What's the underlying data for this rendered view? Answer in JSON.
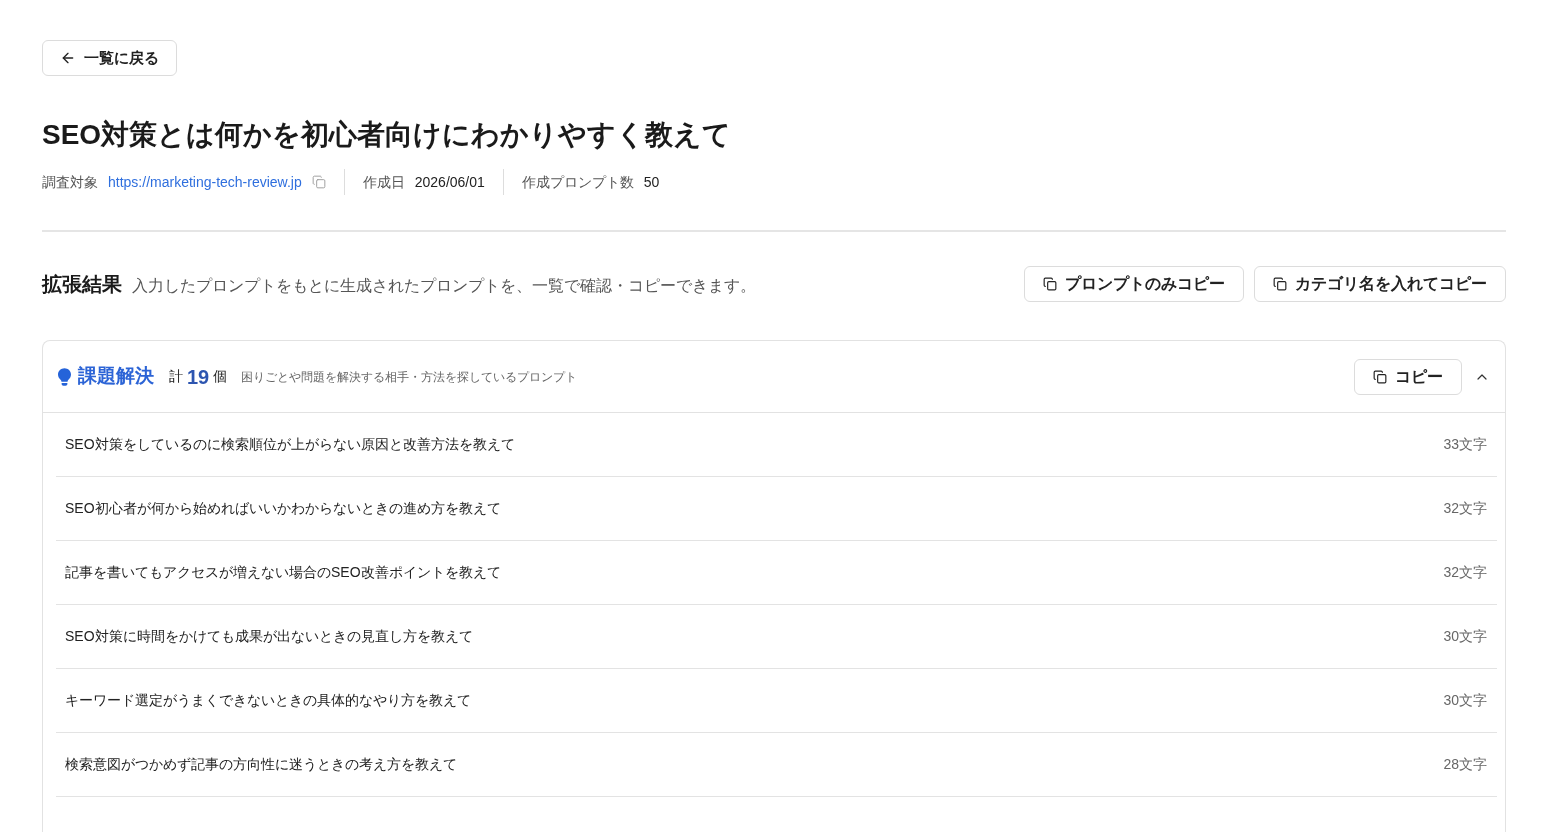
{
  "back_button": {
    "label": "一覧に戻る"
  },
  "title": "SEO対策とは何かを初心者向けにわかりやすく教えて",
  "meta": [
    {
      "kind": "link",
      "label": "調査対象",
      "value": "https://marketing-tech-review.jp"
    },
    {
      "kind": "text",
      "label": "作成日",
      "value": "2026/06/01"
    },
    {
      "kind": "text",
      "label": "作成プロンプト数",
      "value": "50"
    }
  ],
  "results": {
    "heading": "拡張結果",
    "description": "入力したプロンプトをもとに生成されたプロンプトを、一覧で確認・コピーできます。",
    "buttons": [
      "プロンプトのみコピー",
      "カテゴリ名を入れてコピー"
    ]
  },
  "categories": [
    {
      "name": "課題解決",
      "total_prefix": "計",
      "count": "19",
      "total_suffix": "個",
      "description": "困りごとや問題を解決する相手・方法を探しているプロンプト",
      "copy_button": "コピー",
      "expanded": true,
      "prompts": [
        {
          "text": "SEO対策をしているのに検索順位が上がらない原因と改善方法を教えて",
          "length": "33文字"
        },
        {
          "text": "SEO初心者が何から始めればいいかわからないときの進め方を教えて",
          "length": "32文字"
        },
        {
          "text": "記事を書いてもアクセスが増えない場合のSEO改善ポイントを教えて",
          "length": "32文字"
        },
        {
          "text": "SEO対策に時間をかけても成果が出ないときの見直し方を教えて",
          "length": "30文字"
        },
        {
          "text": "キーワード選定がうまくできないときの具体的なやり方を教えて",
          "length": "30文字"
        },
        {
          "text": "検索意図がつかめず記事の方向性に迷うときの考え方を教えて",
          "length": "28文字"
        }
      ]
    }
  ]
}
